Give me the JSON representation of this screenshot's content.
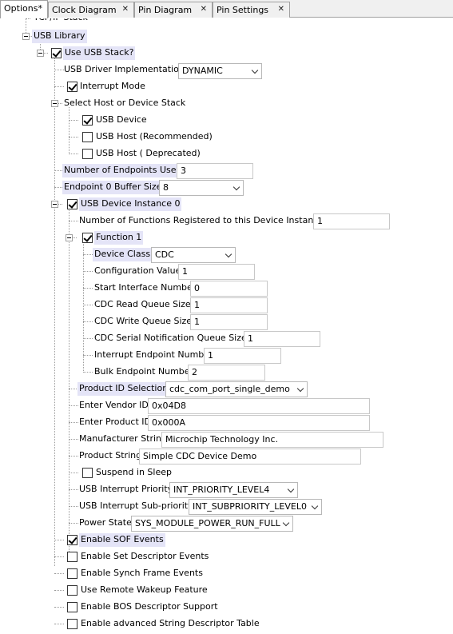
{
  "tabs": [
    {
      "label": "Options*",
      "closable": false,
      "active": true
    },
    {
      "label": "Clock Diagram",
      "closable": true
    },
    {
      "label": "Pin Diagram",
      "closable": true
    },
    {
      "label": "Pin Settings",
      "closable": true
    }
  ],
  "tree": {
    "tcpip_stack": "TCP/IP Stack",
    "usb_library": "USB Library",
    "use_usb_stack": {
      "label": "Use USB Stack?",
      "checked": true
    },
    "driver_impl": {
      "label": "USB Driver Implementation",
      "value": "DYNAMIC"
    },
    "interrupt_mode": {
      "label": "Interrupt Mode",
      "checked": true
    },
    "select_stack": "Select Host or Device Stack",
    "usb_device": {
      "label": "USB Device",
      "checked": true
    },
    "usb_host_rec": {
      "label": "USB Host (Recommended)",
      "checked": false
    },
    "usb_host_dep": {
      "label": "USB Host ( Deprecated)",
      "checked": false
    },
    "num_endpoints": {
      "label": "Number of Endpoints Used",
      "value": "3"
    },
    "ep0_buffer": {
      "label": "Endpoint 0 Buffer Size",
      "value": "8"
    },
    "device_instance": {
      "label": "USB Device Instance 0",
      "checked": true
    },
    "num_functions": {
      "label": "Number of Functions Registered to this Device Instance",
      "value": "1"
    },
    "function1": {
      "label": "Function 1",
      "checked": true
    },
    "device_class": {
      "label": "Device Class",
      "value": "CDC"
    },
    "config_value": {
      "label": "Configuration Value",
      "value": "1"
    },
    "start_interface": {
      "label": "Start Interface Number",
      "value": "0"
    },
    "cdc_read_q": {
      "label": "CDC Read Queue Size",
      "value": "1"
    },
    "cdc_write_q": {
      "label": "CDC Write Queue Size",
      "value": "1"
    },
    "cdc_serial_q": {
      "label": "CDC Serial Notification Queue Size",
      "value": "1"
    },
    "int_endpoint": {
      "label": "Interrupt Endpoint Number",
      "value": "1"
    },
    "bulk_endpoint": {
      "label": "Bulk Endpoint Number",
      "value": "2"
    },
    "product_id_sel": {
      "label": "Product ID Selection",
      "value": "cdc_com_port_single_demo"
    },
    "vendor_id": {
      "label": "Enter Vendor ID",
      "value": "0x04D8"
    },
    "product_id": {
      "label": "Enter Product ID",
      "value": "0x000A"
    },
    "manufacturer": {
      "label": "Manufacturer String",
      "value": "Microchip Technology Inc."
    },
    "product_string": {
      "label": "Product String",
      "value": "Simple CDC Device Demo"
    },
    "suspend_sleep": {
      "label": "Suspend in Sleep",
      "checked": false
    },
    "int_priority": {
      "label": "USB Interrupt Priority",
      "value": "INT_PRIORITY_LEVEL4"
    },
    "int_subpriority": {
      "label": "USB Interrupt Sub-priority",
      "value": "INT_SUBPRIORITY_LEVEL0"
    },
    "power_state": {
      "label": "Power State",
      "value": "SYS_MODULE_POWER_RUN_FULL"
    },
    "sof_events": {
      "label": "Enable SOF Events",
      "checked": true
    },
    "set_desc_events": {
      "label": "Enable Set Descriptor Events",
      "checked": false
    },
    "synch_frame": {
      "label": "Enable Synch Frame Events",
      "checked": false
    },
    "remote_wakeup": {
      "label": "Use Remote Wakeup Feature",
      "checked": false
    },
    "bos_desc": {
      "label": "Enable BOS Descriptor Support",
      "checked": false
    },
    "adv_string_desc": {
      "label": "Enable advanced String Descriptor Table",
      "checked": false
    }
  }
}
